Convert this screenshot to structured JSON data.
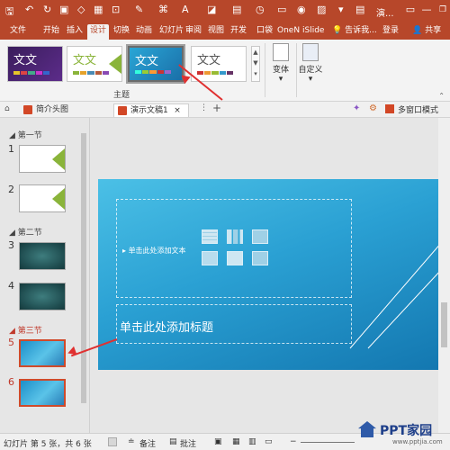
{
  "titlebar": {
    "title": "演...",
    "quick": [
      "💾",
      "↶",
      "↻",
      "▢"
    ]
  },
  "tabs": [
    "文件",
    "开始",
    "插入",
    "设计",
    "切换",
    "动画",
    "幻灯片",
    "审阅",
    "视图",
    "开发",
    "口袋",
    "OneN",
    "iSlide",
    "告诉我...",
    "登录",
    "共享"
  ],
  "active_tab": "设计",
  "ribbon": {
    "theme_text": "文文",
    "group_label": "主题",
    "variants_label": "变体",
    "customize_label": "自定义"
  },
  "doctabs": {
    "tab1": "简介头图",
    "tab2": "演示文稿1",
    "multiwin": "多窗口模式"
  },
  "sections": [
    "第一节",
    "第二节",
    "第三节"
  ],
  "slide_numbers": [
    "1",
    "2",
    "3",
    "4",
    "5",
    "6"
  ],
  "slide": {
    "content_placeholder": "单击此处添加文本",
    "title_placeholder": "单击此处添加标题"
  },
  "status": {
    "slide_info": "幻灯片 第 5 张，共 6 张",
    "notes": "备注",
    "comments": "批注"
  },
  "watermark": "PPT家园",
  "watermark_url": "www.pptjia.com"
}
